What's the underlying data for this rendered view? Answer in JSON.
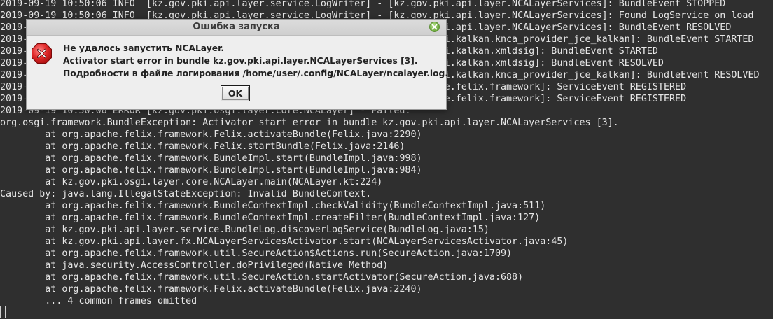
{
  "terminal": {
    "lines": [
      "2019-09-19 10:50:06 INFO  [kz.gov.pki.api.layer.service.LogWriter] - [kz.gov.pki.api.layer.NCALayerServices]: BundleEvent STOPPED",
      "2019-09-19 10:50:06 INFO  [kz.gov.pki.api.layer.service.LogWriter] - [kz.gov.pki.api.layer.NCALayerServices]: Found LogService on load",
      "2019-09-19 10:50:06 INFO  [kz.gov.pki.api.layer.service.LogWriter] - [kz.gov.pki.api.layer.NCALayerServices]: BundleEvent RESOLVED",
      "2019-09-19 10:50:06 INFO  [kz.gov.pki.api.layer.service.LogWriter] - [kz.gov.pki.kalkan.knca_provider_jce_kalkan]: BundleEvent STARTED",
      "2019-09-19 10:50:06 INFO  [kz.gov.pki.api.layer.service.LogWriter] - [kz.gov.pki.kalkan.xmldsig]: BundleEvent STARTED",
      "2019-09-19 10:50:06 INFO  [kz.gov.pki.api.layer.service.LogWriter] - [kz.gov.pki.kalkan.xmldsig]: BundleEvent RESOLVED",
      "2019-09-19 10:50:06 INFO  [kz.gov.pki.api.layer.service.LogWriter] - [kz.gov.pki.kalkan.knca_provider_jce_kalkan]: BundleEvent RESOLVED",
      "2019-09-19 10:50:06 INFO  [kz.gov.pki.api.layer.service.LogWriter] - [org.apache.felix.framework]: ServiceEvent REGISTERED",
      "2019-09-19 10:50:06 INFO  [kz.gov.pki.api.layer.service.LogWriter] - [org.apache.felix.framework]: ServiceEvent REGISTERED",
      "2019-09-19 10:50:06 ERROR [kz.gov.pki.osgi.layer.core.NCALayer] - Failed:",
      "org.osgi.framework.BundleException: Activator start error in bundle kz.gov.pki.api.layer.NCALayerServices [3].",
      "        at org.apache.felix.framework.Felix.activateBundle(Felix.java:2290)",
      "        at org.apache.felix.framework.Felix.startBundle(Felix.java:2146)",
      "        at org.apache.felix.framework.BundleImpl.start(BundleImpl.java:998)",
      "        at org.apache.felix.framework.BundleImpl.start(BundleImpl.java:984)",
      "        at kz.gov.pki.osgi.layer.core.NCALayer.main(NCALayer.kt:224)",
      "Caused by: java.lang.IllegalStateException: Invalid BundleContext.",
      "        at org.apache.felix.framework.BundleContextImpl.checkValidity(BundleContextImpl.java:511)",
      "        at org.apache.felix.framework.BundleContextImpl.createFilter(BundleContextImpl.java:127)",
      "        at kz.gov.pki.api.layer.service.BundleLog.discoverLogService(BundleLog.java:15)",
      "        at kz.gov.pki.api.layer.fx.NCALayerServicesActivator.start(NCALayerServicesActivator.java:45)",
      "        at org.apache.felix.framework.util.SecureAction$Actions.run(SecureAction.java:1709)",
      "        at java.security.AccessController.doPrivileged(Native Method)",
      "        at org.apache.felix.framework.util.SecureAction.startActivator(SecureAction.java:688)",
      "        at org.apache.felix.framework.Felix.activateBundle(Felix.java:2240)",
      "        ... 4 common frames omitted"
    ]
  },
  "dialog": {
    "title": "Ошибка запуска",
    "close_icon": "close-icon",
    "error_icon": "error-icon",
    "message": {
      "line1": "Не удалось запустить NCALayer.",
      "line2": "Activator start error in bundle kz.gov.pki.api.layer.NCALayerServices [3].",
      "line3": "Подробности в файле логирования /home/user/.config/NCALayer/ncalayer.log."
    },
    "ok_label": "OK"
  },
  "colors": {
    "terminal_bg": "#2f2f2f",
    "terminal_text": "#e6e6e6",
    "dialog_bg": "#eeeeee",
    "error_red": "#d62020"
  }
}
